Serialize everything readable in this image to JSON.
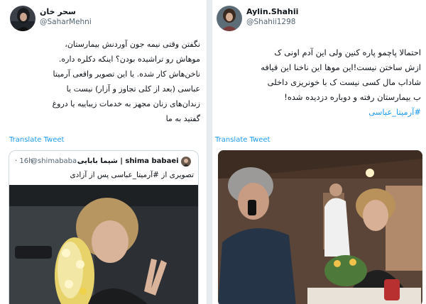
{
  "left_tweet": {
    "author_name": "سحر خان",
    "author_handle": "@SaharMehni",
    "body_lines": [
      "نگفتن وقتی نیمه جون آوردنش بیمارستان،",
      "موهاش رو تراشیده بودن؟ اینکه دکلره داره.",
      "ناخن‌هاش کار شده. یا این تصویر واقعی آرمیتا",
      "عباسی (بعد از کلی تجاوز و آزار) نیست یا",
      "زندان‌های زنان مجهز به خدمات زیباییه یا دروغ",
      "گفتید به ما"
    ],
    "translate_label": "Translate Tweet",
    "quoted": {
      "author_name": "شیما بابایی | shima babaei",
      "author_handle": "@shimababa...",
      "time": "· 16h",
      "text": "تصویری از #آرمیتا_عباسی پس از آزادی"
    }
  },
  "right_tweet": {
    "author_name": "Aylin.Shahii",
    "author_handle": "@Shahii1298",
    "body_lines": [
      "احتمالا پاچمو پاره کنین ولی این آدم اونی ک",
      "ازش ساختن نیست!این موها این ناخنا این قیافه",
      "شاداب مال کسی نیست ک با خونریزی داخلی",
      "ب بیمارستان رفته و دوباره دزدیده شده!"
    ],
    "hashtag": "#آرمیتا_عباسی",
    "translate_label": "Translate Tweet"
  },
  "colors": {
    "link": "#1d9bf0",
    "text": "#0f1419",
    "muted": "#536471",
    "border": "#cfd9de"
  },
  "icons": {
    "left_avatar": "profile-photo-avatar",
    "right_avatar": "profile-photo-avatar",
    "quote_avatar": "profile-photo-avatar"
  }
}
